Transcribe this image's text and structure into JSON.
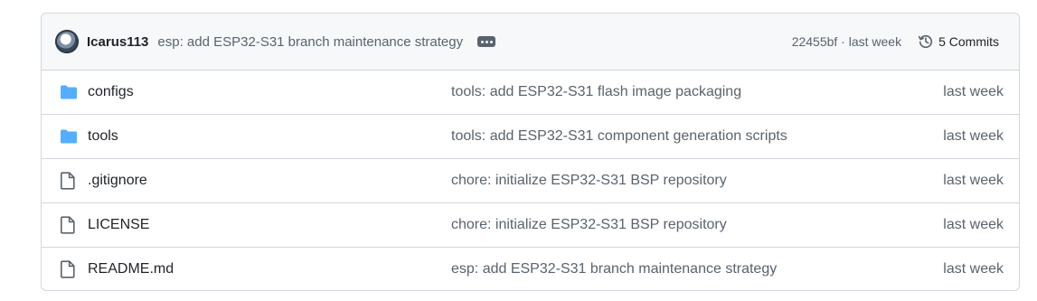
{
  "latest_commit": {
    "author": "Icarus113",
    "message": "esp: add ESP32-S31 branch maintenance strategy",
    "sha_time": "22455bf · last week",
    "commits_label": "5 Commits"
  },
  "colors": {
    "folder": "#54aeff",
    "muted": "#59636e",
    "border": "#d0d7de"
  },
  "files": [
    {
      "type": "folder",
      "icon": "folder-icon",
      "name": "configs",
      "message": "tools: add ESP32-S31 flash image packaging",
      "date": "last week"
    },
    {
      "type": "folder",
      "icon": "folder-icon",
      "name": "tools",
      "message": "tools: add ESP32-S31 component generation scripts",
      "date": "last week"
    },
    {
      "type": "file",
      "icon": "file-icon",
      "name": ".gitignore",
      "message": "chore: initialize ESP32-S31 BSP repository",
      "date": "last week"
    },
    {
      "type": "file",
      "icon": "file-icon",
      "name": "LICENSE",
      "message": "chore: initialize ESP32-S31 BSP repository",
      "date": "last week"
    },
    {
      "type": "file",
      "icon": "file-icon",
      "name": "README.md",
      "message": "esp: add ESP32-S31 branch maintenance strategy",
      "date": "last week"
    }
  ]
}
